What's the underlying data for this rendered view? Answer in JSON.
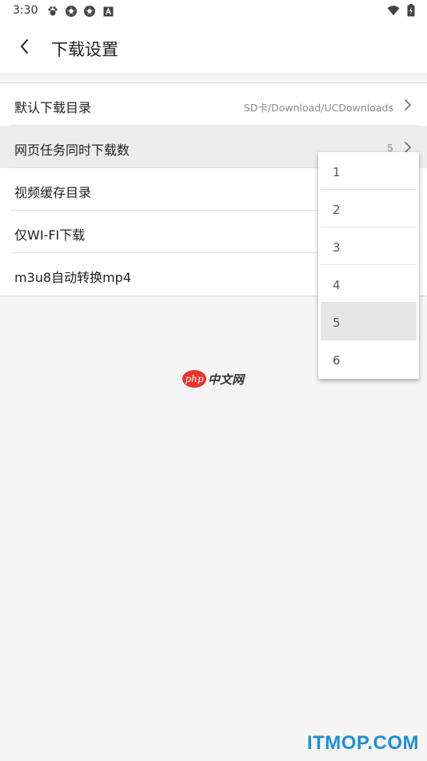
{
  "status_bar": {
    "time": "3:30",
    "left_icons": [
      "paw-icon",
      "settings-app-icon",
      "settings-app-icon",
      "a-box-icon"
    ],
    "right_icons": [
      "wifi-icon",
      "battery-icon"
    ]
  },
  "header": {
    "back_icon": "chevron-left-icon",
    "title": "下载设置"
  },
  "settings": {
    "items": [
      {
        "label": "默认下载目录",
        "value": "SD卡/Download/UCDownloads",
        "has_chevron": true
      },
      {
        "label": "网页任务同时下载数",
        "value": "5",
        "has_chevron": true
      },
      {
        "label": "视频缓存目录",
        "value": "",
        "has_chevron": false
      },
      {
        "label": "仅WI-FI下载",
        "value": "",
        "has_chevron": false
      },
      {
        "label": "m3u8自动转换mp4",
        "value": "",
        "has_chevron": false
      }
    ]
  },
  "dropdown": {
    "options": [
      "1",
      "2",
      "3",
      "4",
      "5",
      "6"
    ],
    "selected": "5"
  },
  "watermark": {
    "badge": "php",
    "text": "中文网"
  },
  "footer": {
    "brand": "ITMOP.COM"
  },
  "colors": {
    "background": "#f5f5f5",
    "surface": "#ffffff",
    "selected_row": "#ededed",
    "brand_blue": "#1f8fce",
    "php_red": "#e8322d"
  }
}
